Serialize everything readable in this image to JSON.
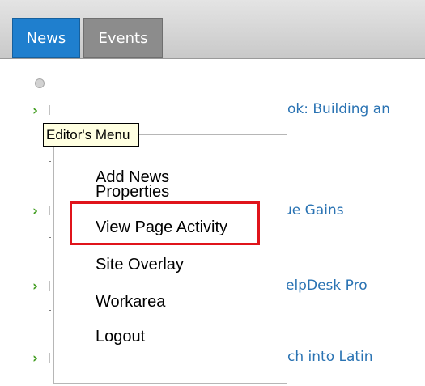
{
  "tabs": [
    {
      "label": "News"
    },
    {
      "label": "Events"
    }
  ],
  "news_items": [
    {
      "title_fragment": "ok: Building an"
    },
    {
      "title_fragment": "ue Gains"
    },
    {
      "title_fragment": "elpDesk Pro"
    },
    {
      "title_fragment": "ch into Latin"
    }
  ],
  "tooltip": {
    "text": "Editor's Menu"
  },
  "menu": {
    "items": [
      {
        "label": "Add News"
      },
      {
        "label": "Properties"
      },
      {
        "label": "View Page Activity"
      },
      {
        "label": "Site Overlay"
      },
      {
        "label": "Workarea"
      },
      {
        "label": "Logout"
      }
    ],
    "highlighted_item": "View Page Activity",
    "highlight_color": "#e0141b"
  },
  "colors": {
    "news_tab_active": "#1f7fce",
    "events_tab": "#8c8c8c",
    "link": "#2a73b3",
    "bullet": "#3d9b1b",
    "tooltip_bg": "#ffffe1"
  },
  "icons": {
    "bullet": "chevron-right-icon",
    "loader": "loading-dot-icon"
  }
}
